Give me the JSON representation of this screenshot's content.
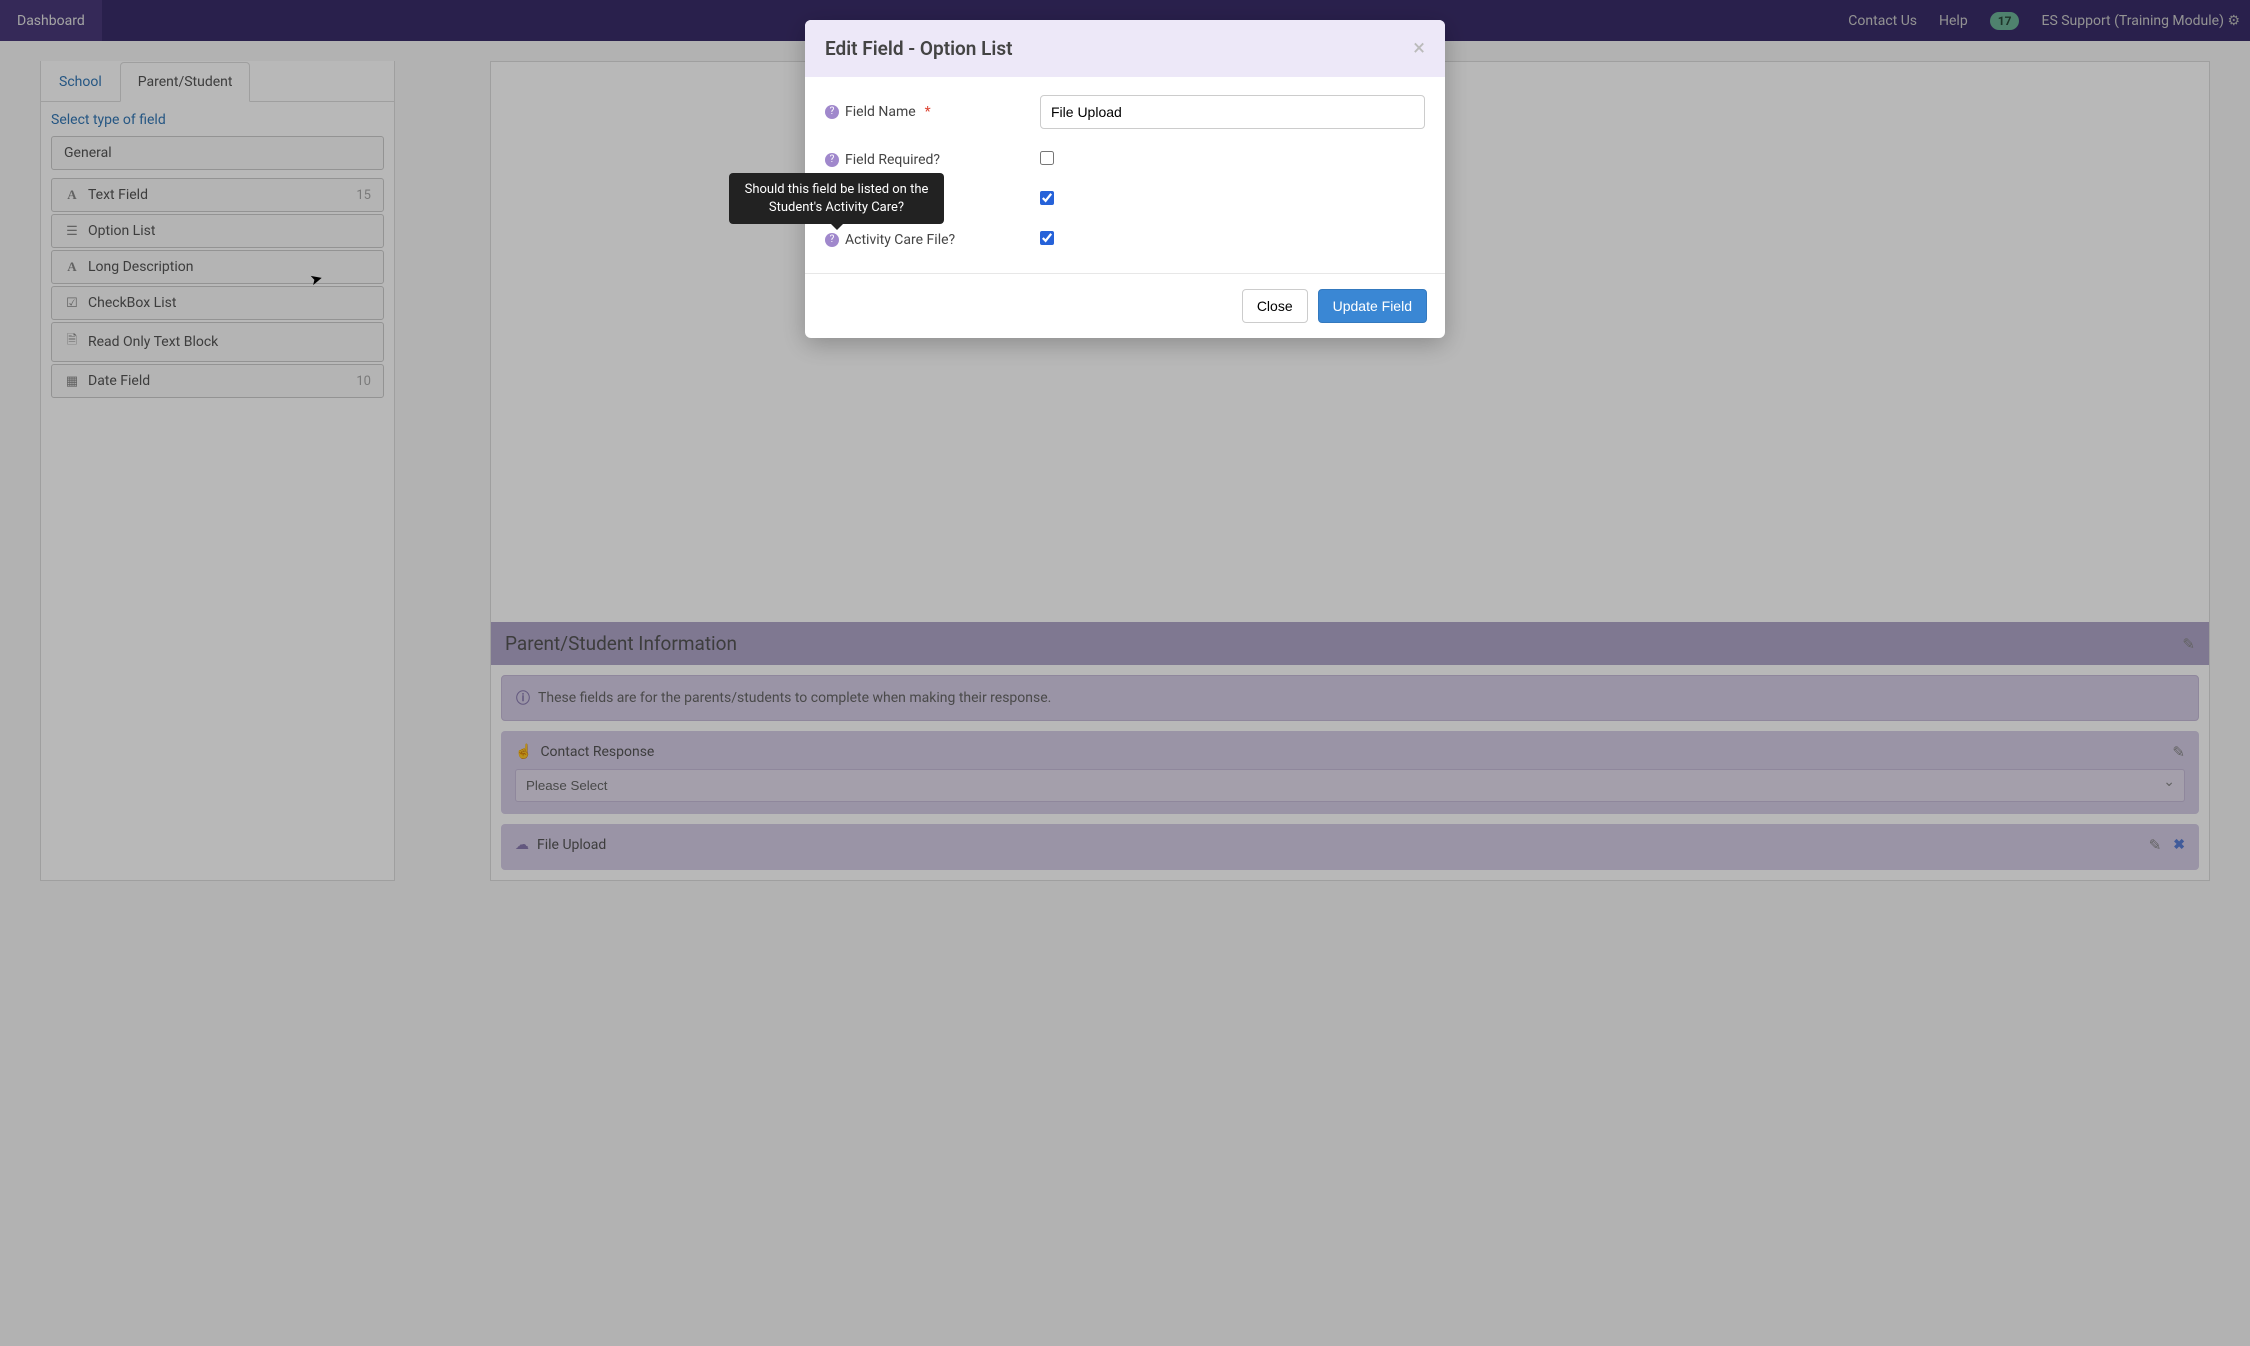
{
  "nav": {
    "dashboard": "Dashboard",
    "contact_us": "Contact Us",
    "help": "Help",
    "badge": "17",
    "user_label": "ES Support (Training Module)"
  },
  "sidebar": {
    "tabs": [
      "School",
      "Parent/Student"
    ],
    "active_tab": 1,
    "select_label": "Select type of field",
    "select_value": "General",
    "items": [
      {
        "icon": "A",
        "label": "Text Field",
        "count": "15"
      },
      {
        "icon": "≡",
        "label": "Option List",
        "count": ""
      },
      {
        "icon": "A",
        "label": "Long Description",
        "count": ""
      },
      {
        "icon": "☑",
        "label": "CheckBox List",
        "count": ""
      },
      {
        "icon": "📄",
        "label": "Read Only Text Block",
        "count": ""
      },
      {
        "icon": "📅",
        "label": "Date Field",
        "count": "10"
      }
    ]
  },
  "section": {
    "title": "Parent/Student Information",
    "info": "These fields are for the parents/students to complete when making their response.",
    "cards": [
      {
        "icon": "👆",
        "title": "Contact Response",
        "select_value": "Please Select",
        "has_select": true,
        "has_delete": false
      },
      {
        "icon": "☁️",
        "title": "File Upload",
        "has_select": false,
        "has_delete": true
      }
    ]
  },
  "modal": {
    "title": "Edit Field - Option List",
    "field_name_label": "Field Name",
    "field_name_value": "File Upload",
    "field_required_label": "Field Required?",
    "field_required_checked": false,
    "activity_care_file_label": "Activity Care File?",
    "activity_care_file_checked": true,
    "hidden_row_checked": true,
    "close_btn": "Close",
    "update_btn": "Update Field"
  },
  "tooltip": {
    "text": "Should this field be listed on the Student's Activity Care?"
  }
}
